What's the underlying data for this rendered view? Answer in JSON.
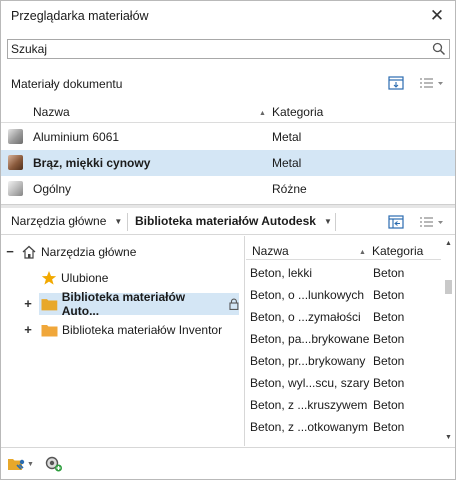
{
  "window": {
    "title": "Przeglądarka materiałów",
    "close": "✕"
  },
  "search": {
    "placeholder": "Szukaj"
  },
  "document": {
    "section_title": "Materiały dokumentu",
    "columns": {
      "name": "Nazwa",
      "category": "Kategoria"
    },
    "rows": [
      {
        "name": "Aluminium 6061",
        "category": "Metal",
        "swatch": "#9a9a9a"
      },
      {
        "name": "Brąz, miękki cynowy",
        "category": "Metal",
        "swatch": "#8a5a3c"
      },
      {
        "name": "Ogólny",
        "category": "Różne",
        "swatch": "#b9b9b9"
      }
    ]
  },
  "library_bar": {
    "home_dropdown": "Narzędzia główne",
    "library_dropdown": "Biblioteka materiałów Autodesk"
  },
  "tree": {
    "root": "Narzędzia główne",
    "favorites": "Ulubione",
    "autodesk": "Biblioteka materiałów Auto...",
    "inventor": "Biblioteka materiałów Inventor",
    "expand": "+",
    "collapse": "−"
  },
  "library_grid": {
    "columns": {
      "name": "Nazwa",
      "category": "Kategoria"
    },
    "rows": [
      {
        "name": "Beton, lekki",
        "category": "Beton"
      },
      {
        "name": "Beton, o ...lunkowych",
        "category": "Beton"
      },
      {
        "name": "Beton, o ...zymałości",
        "category": "Beton"
      },
      {
        "name": "Beton, pa...brykowane",
        "category": "Beton"
      },
      {
        "name": "Beton, pr...brykowany",
        "category": "Beton"
      },
      {
        "name": "Beton, wyl...scu, szary",
        "category": "Beton"
      },
      {
        "name": "Beton, z ...kruszywem",
        "category": "Beton"
      },
      {
        "name": "Beton, z ...otkowanym",
        "category": "Beton"
      }
    ]
  },
  "colors": {
    "selection": "#d4e6f5",
    "folder": "#e8a82a",
    "star": "#f2a900"
  }
}
